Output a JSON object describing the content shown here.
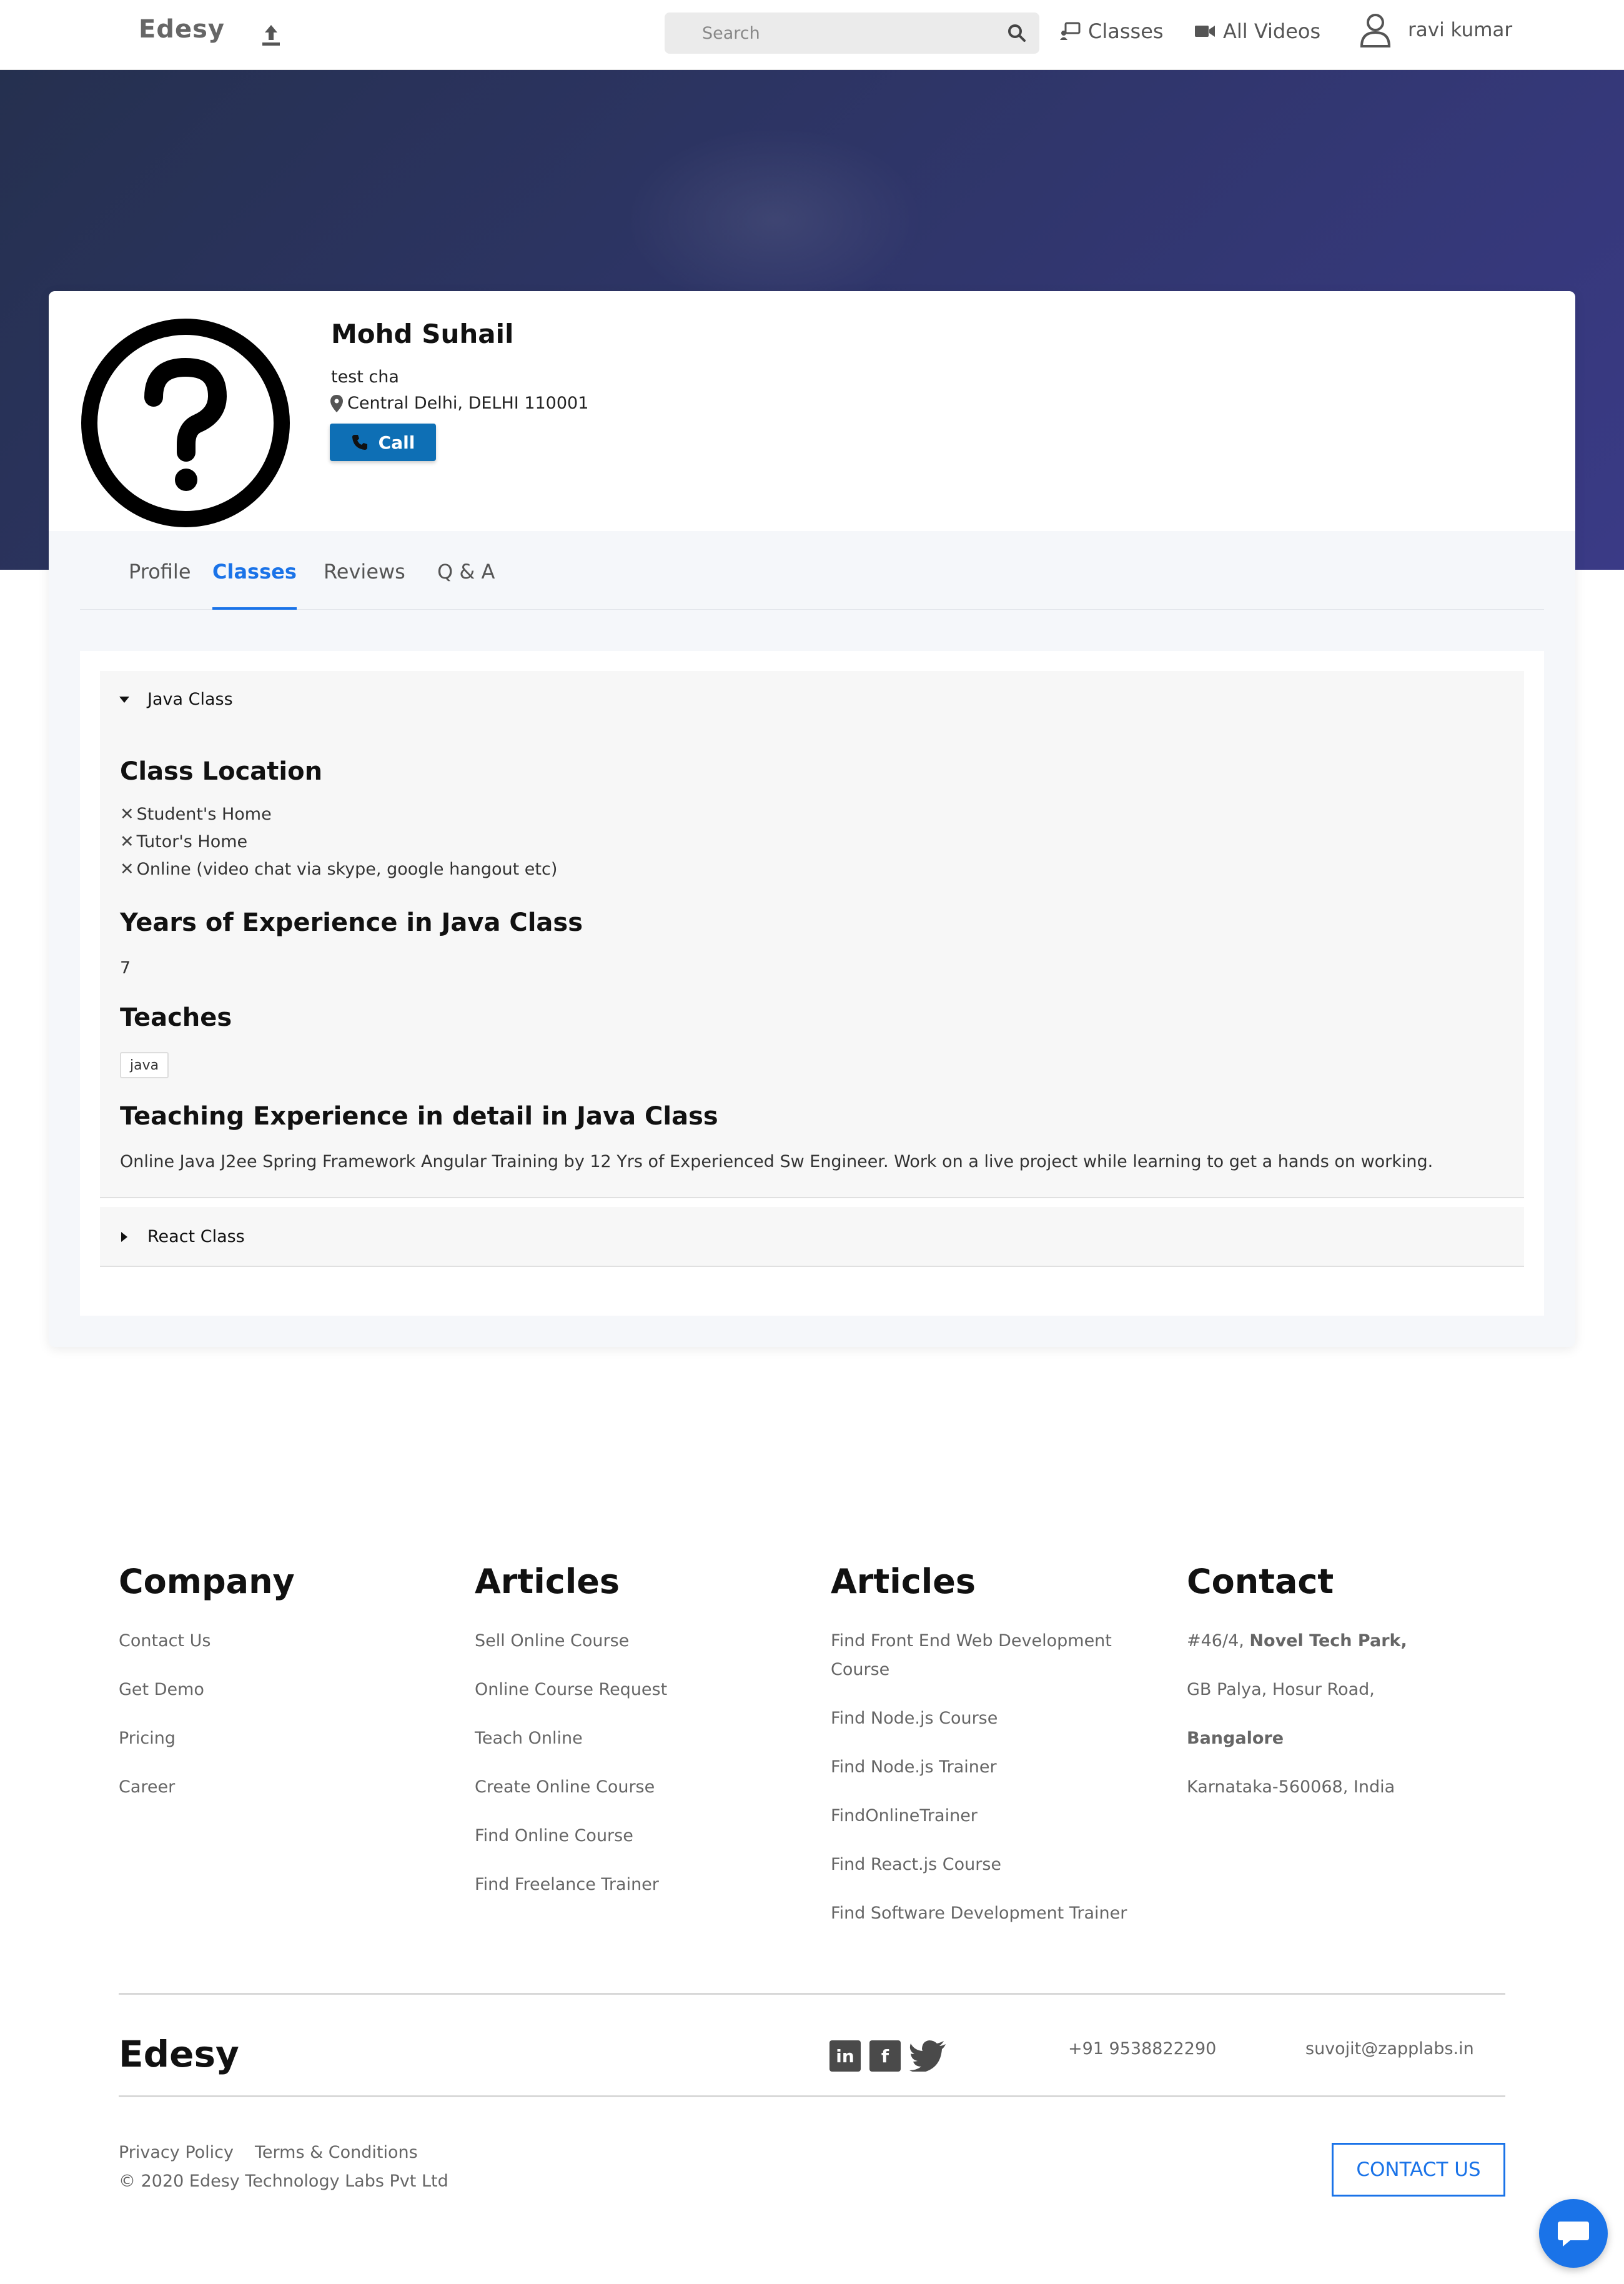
{
  "navbar": {
    "logo": "Edesy",
    "search_placeholder": "Search",
    "classes_label": "Classes",
    "videos_label": "All Videos",
    "user_name": "ravi kumar"
  },
  "profile": {
    "name": "Mohd Suhail",
    "subtitle": "test cha",
    "location": "Central Delhi, DELHI 110001",
    "call_label": "Call"
  },
  "tabs": [
    {
      "label": "Profile",
      "active": false
    },
    {
      "label": "Classes",
      "active": true
    },
    {
      "label": "Reviews",
      "active": false
    },
    {
      "label": "Q & A",
      "active": false
    }
  ],
  "classes": [
    {
      "title": "Java Class",
      "expanded": true,
      "location_heading": "Class Location",
      "locations": [
        "Student's Home",
        "Tutor's Home",
        "Online (video chat via skype, google hangout etc)"
      ],
      "experience_heading": "Years of Experience in Java Class",
      "experience_value": "7",
      "teaches_heading": "Teaches",
      "teaches_tags": [
        "java"
      ],
      "detail_heading": "Teaching Experience in detail in Java Class",
      "detail_text": "Online Java J2ee Spring Framework Angular Training by 12 Yrs of Experienced Sw Engineer. Work on a live project while learning to get a hands on working."
    },
    {
      "title": "React Class",
      "expanded": false
    }
  ],
  "footer": {
    "company": {
      "title": "Company",
      "links": [
        "Contact Us",
        "Get Demo",
        "Pricing",
        "Career"
      ]
    },
    "articles1": {
      "title": "Articles",
      "links": [
        "Sell Online Course",
        "Online Course Request",
        "Teach Online",
        "Create Online Course",
        "Find Online Course",
        "Find Freelance Trainer"
      ]
    },
    "articles2": {
      "title": "Articles",
      "links": [
        "Find Front End Web Development",
        "Course",
        "Find Node.js Course",
        "Find Node.js Trainer",
        "FindOnlineTrainer",
        "Find React.js Course",
        "Find Software Development Trainer"
      ]
    },
    "contact": {
      "title": "Contact",
      "line1_prefix": "#46/4, ",
      "line1_bold": "Novel Tech Park,",
      "line2": "GB Palya, Hosur Road,",
      "line3": "Bangalore",
      "line4": "Karnataka-560068, India"
    },
    "brand": "Edesy",
    "social": [
      "linkedin-icon",
      "facebook-icon",
      "twitter-icon"
    ],
    "phone": "+91 9538822290",
    "email": "suvojit@zapplabs.in",
    "privacy": "Privacy Policy",
    "terms": "Terms & Conditions",
    "copyright": "© 2020 Edesy Technology Labs Pvt Ltd",
    "contact_button": "CONTACT US"
  },
  "colors": {
    "accent": "#1a73e8",
    "call_button": "#0e6fb5",
    "banner": "#2e3567"
  }
}
